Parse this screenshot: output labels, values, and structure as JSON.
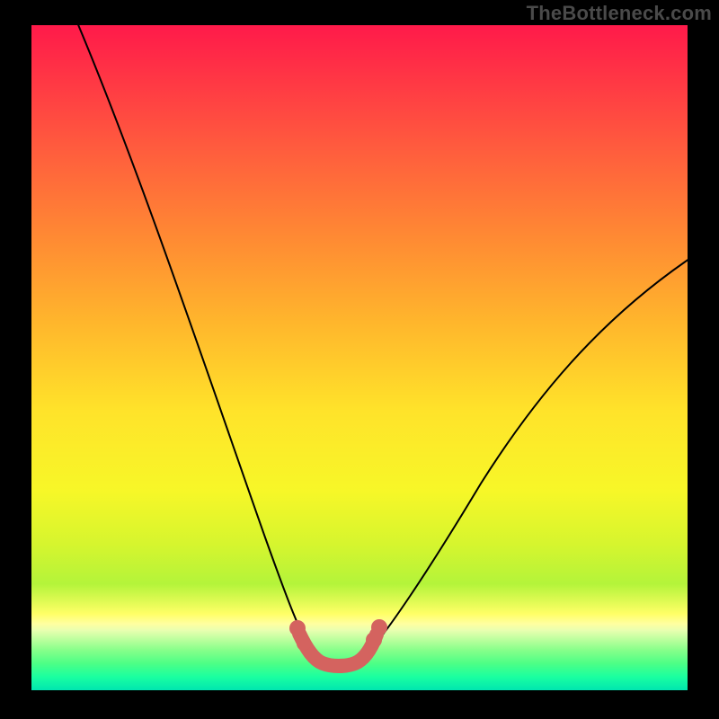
{
  "watermark": "TheBottleneck.com",
  "chart_data": {
    "type": "line",
    "title": "",
    "xlabel": "",
    "ylabel": "",
    "xlim": [
      0,
      100
    ],
    "ylim": [
      0,
      100
    ],
    "grid": false,
    "legend": false,
    "notes": "Bottleneck curve with vertical red-to-green gradient background. No axis ticks, labels, or legend. Curve minimum (green/marker region) near x≈41–51. Watermark text in top-right.",
    "series": [
      {
        "name": "bottleneck-curve",
        "x": [
          5,
          10,
          15,
          20,
          25,
          30,
          35,
          40,
          45,
          50,
          55,
          60,
          65,
          70,
          75,
          80,
          85,
          90,
          95,
          100
        ],
        "values": [
          100,
          88,
          76,
          64,
          52,
          40,
          28,
          14,
          5,
          5,
          12,
          22,
          31,
          39,
          46,
          52,
          57,
          61,
          64,
          66
        ]
      }
    ],
    "highlight_region": {
      "x_start": 40,
      "x_end": 52,
      "description": "Pink/salmon marker segment tracing the curve minimum, with small round endpoints."
    },
    "background_gradient": {
      "direction": "top-to-bottom",
      "stops": [
        {
          "pos": 0,
          "color": "#ff1a4a"
        },
        {
          "pos": 50,
          "color": "#ffcf2a"
        },
        {
          "pos": 88,
          "color": "#ffff66"
        },
        {
          "pos": 100,
          "color": "#00e6b0"
        }
      ]
    }
  }
}
